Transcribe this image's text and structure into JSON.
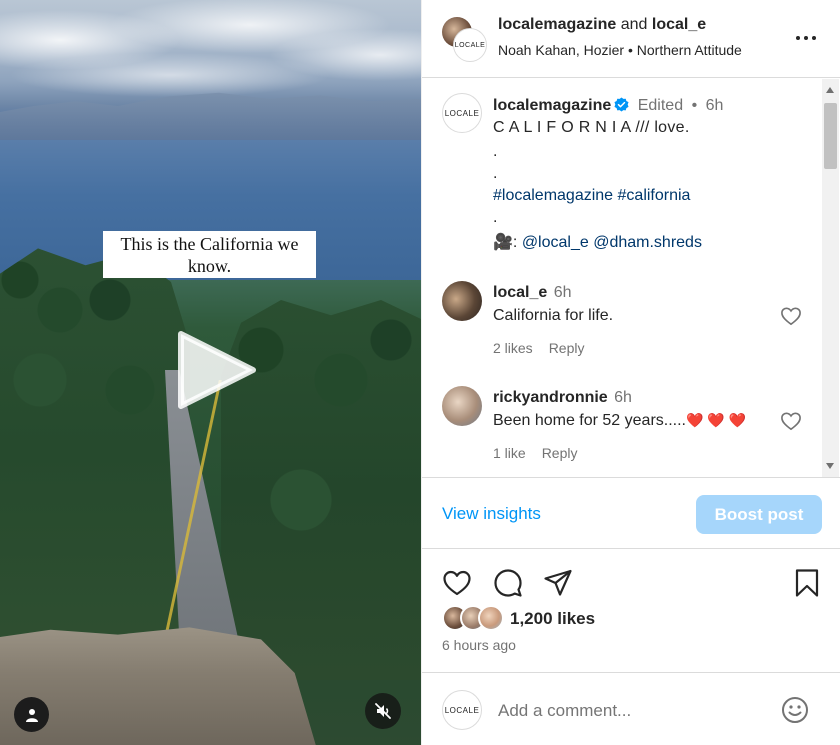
{
  "video": {
    "overlay_text": "This is the California we know.",
    "play_icon": "play-icon",
    "user_icon": "person-icon",
    "mute_icon": "muted-speaker-icon"
  },
  "header": {
    "user1": "localemagazine",
    "connector": " and ",
    "user2": "local_e",
    "audio": "Noah Kahan, Hozier • Northern Attitude",
    "logo_text": "LOCALE",
    "more_icon": "more-options-icon"
  },
  "caption": {
    "username": "localemagazine",
    "edited": "Edited",
    "dot": "•",
    "time": "6h",
    "line1": "C A L I F O R N I A /// love.",
    "dot1": ".",
    "dot2": ".",
    "hashtags": "#localemagazine #california",
    "dot3": ".",
    "camera_emoji": "🎥",
    "credits_prefix": ": ",
    "credits": "@local_e @dham.shreds",
    "logo_text": "LOCALE"
  },
  "comments": [
    {
      "username": "local_e",
      "time": "6h",
      "text": "California for life.",
      "likes": "2 likes",
      "reply": "Reply"
    },
    {
      "username": "rickyandronnie",
      "time": "6h",
      "text": "Been home for 52 years.....",
      "hearts": "❤️ ❤️ ❤️",
      "likes": "1 like",
      "reply": "Reply"
    }
  ],
  "insights": {
    "view_insights": "View insights",
    "boost_post": "Boost post"
  },
  "post": {
    "likes": "1,200 likes",
    "time_ago": "6 hours ago"
  },
  "comment_box": {
    "placeholder": "Add a comment...",
    "logo_text": "LOCALE",
    "emoji_icon": "emoji-icon"
  },
  "colors": {
    "accent": "#0095f6",
    "boost_disabled": "#a6d6fb",
    "link": "#00376b",
    "muted": "#737373"
  }
}
